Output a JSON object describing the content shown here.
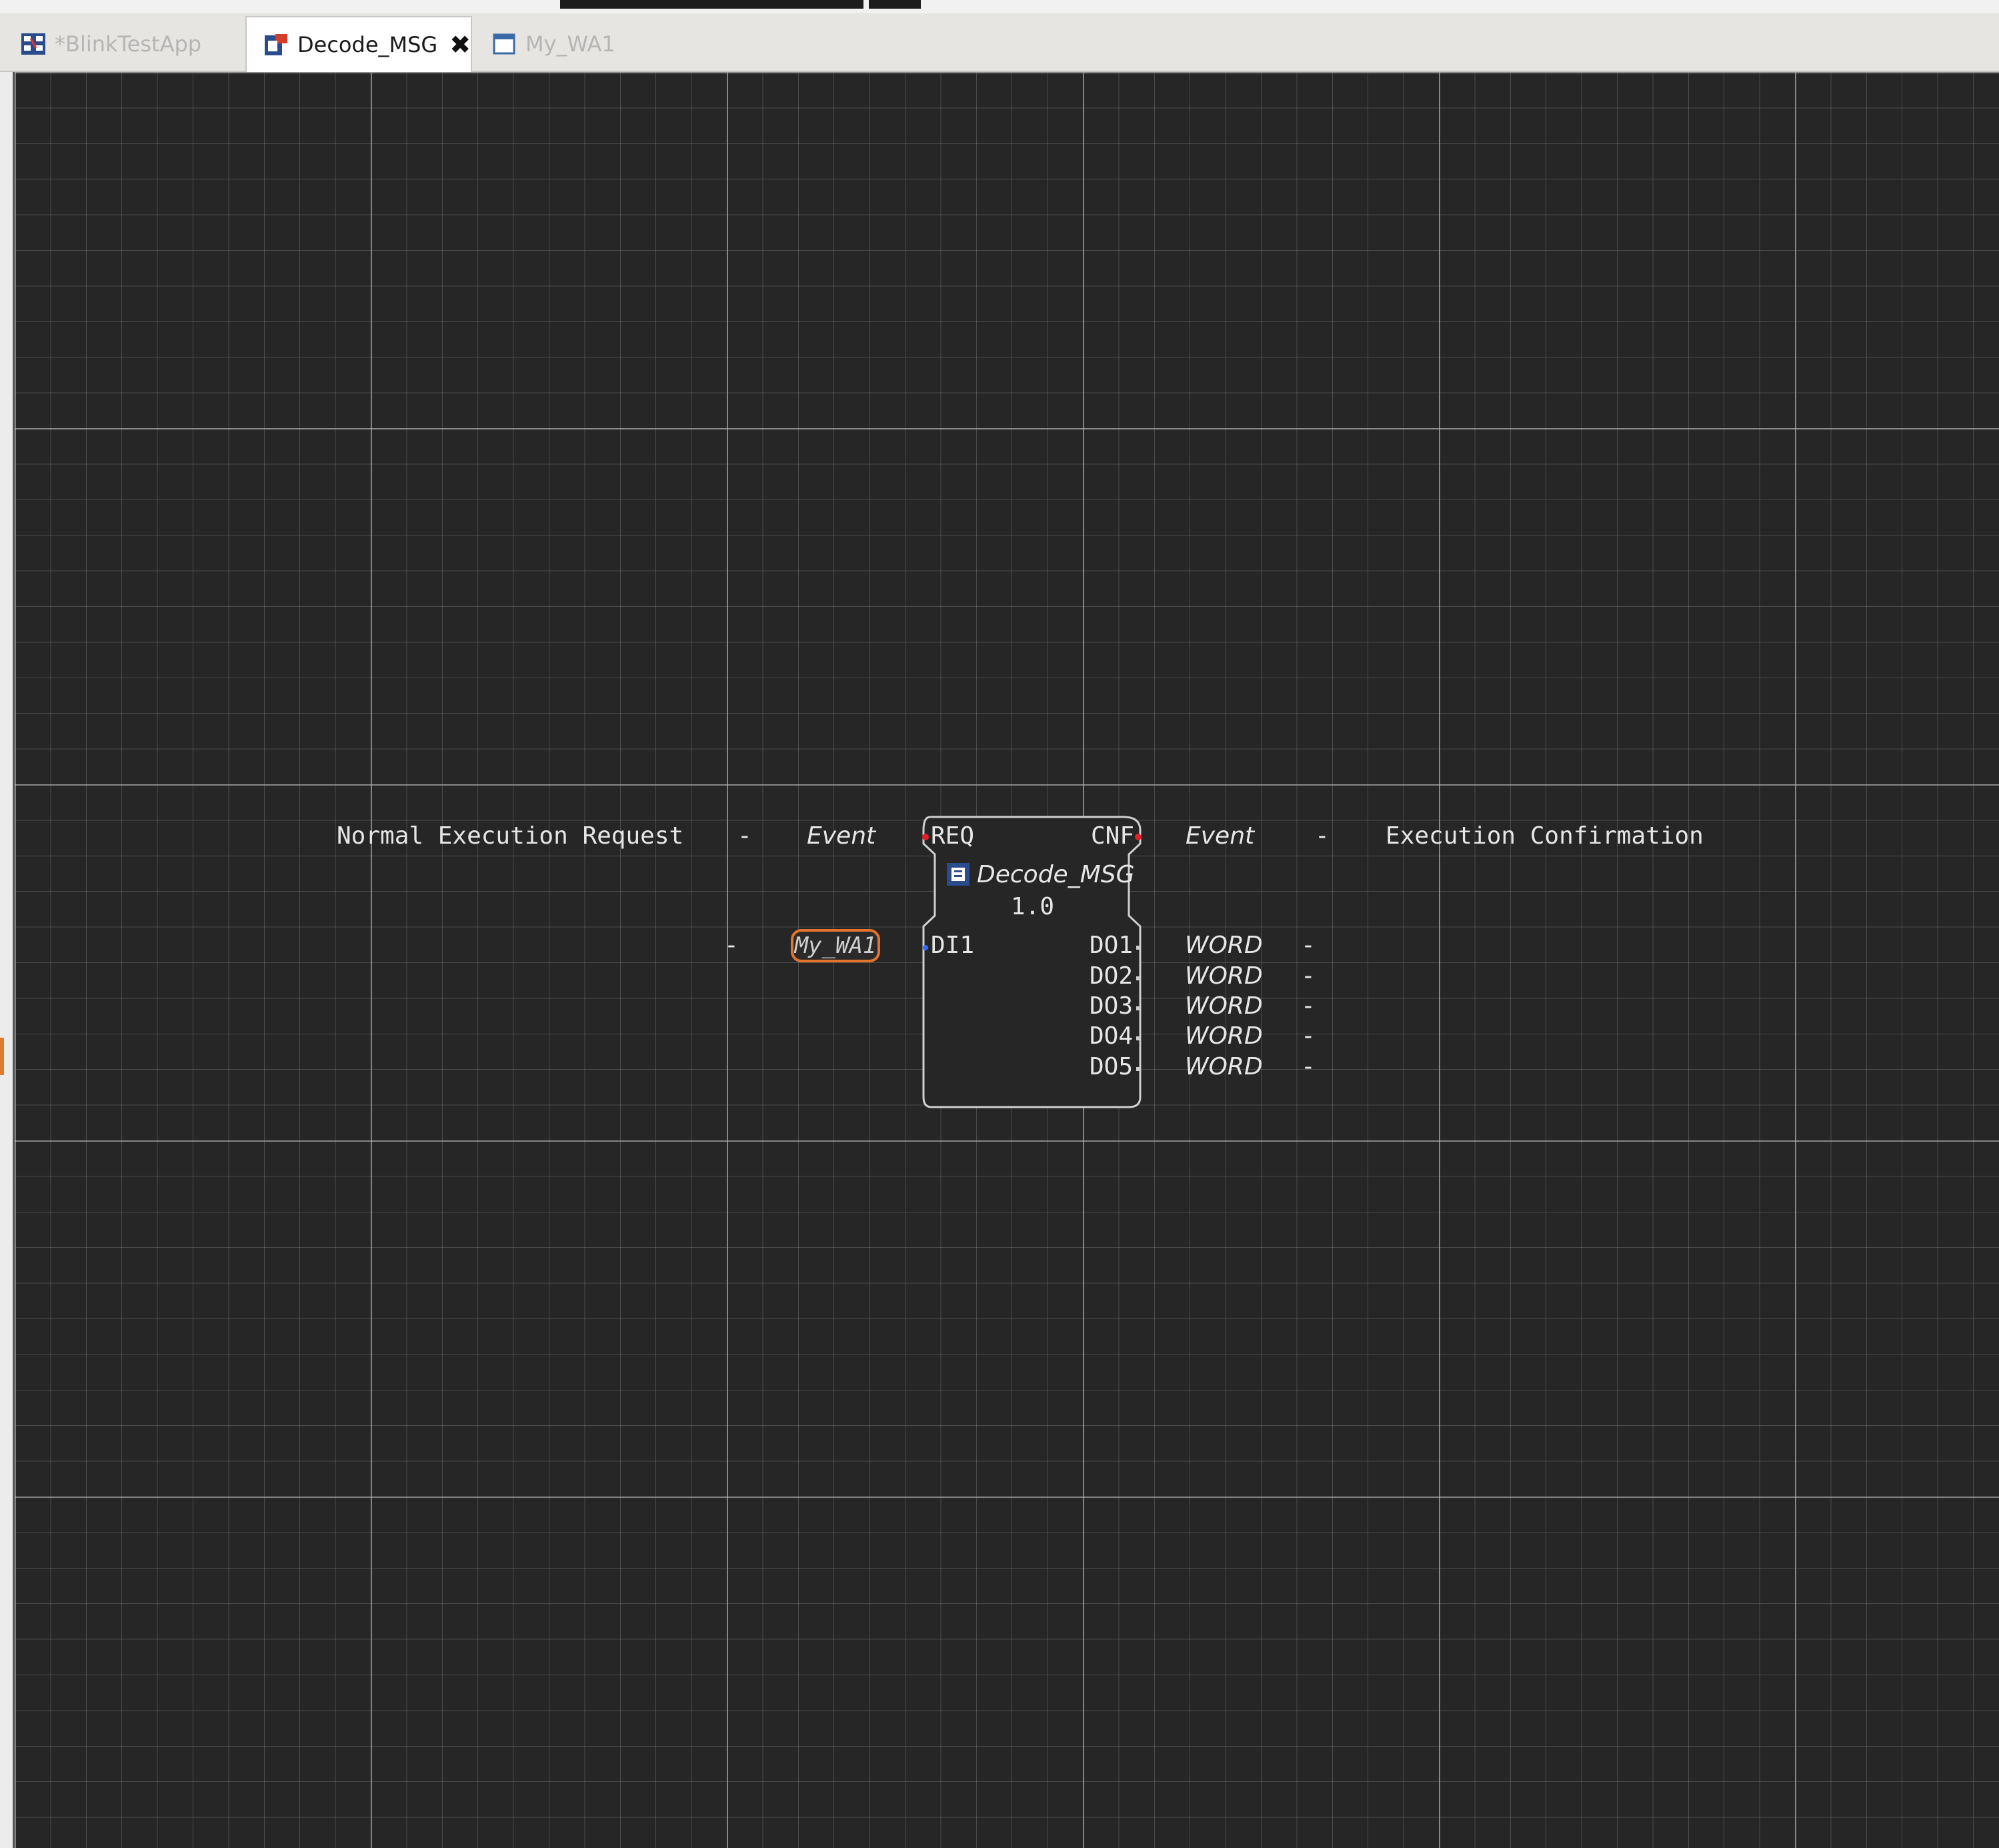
{
  "tabs": [
    {
      "label": "*BlinkTestApp",
      "icon": "application-icon",
      "active": false
    },
    {
      "label": "Decode_MSG",
      "icon": "function-block-type-icon",
      "active": true,
      "close": "✖"
    },
    {
      "label": "My_WA1",
      "icon": "window-icon",
      "active": false
    }
  ],
  "diagram": {
    "event_input": {
      "comment": "Normal Execution Request",
      "dash": "-",
      "type": "Event",
      "name": "REQ"
    },
    "event_output": {
      "name": "CNF",
      "type": "Event",
      "dash": "-",
      "comment": "Execution Confirmation"
    },
    "block": {
      "name": "Decode_MSG",
      "version": "1.0"
    },
    "data_input": {
      "dash": "-",
      "type": "My_WA1",
      "name": "DI1"
    },
    "data_outputs": [
      {
        "name": "DO1",
        "type": "WORD",
        "dash": "-"
      },
      {
        "name": "DO2",
        "type": "WORD",
        "dash": "-"
      },
      {
        "name": "DO3",
        "type": "WORD",
        "dash": "-"
      },
      {
        "name": "DO4",
        "type": "WORD",
        "dash": "-"
      },
      {
        "name": "DO5",
        "type": "WORD",
        "dash": "-"
      }
    ]
  },
  "colors": {
    "canvas": "#262626",
    "event_pin": "#e0202a",
    "data_pin": "#2f6bff",
    "struct_highlight": "#e2742e"
  }
}
